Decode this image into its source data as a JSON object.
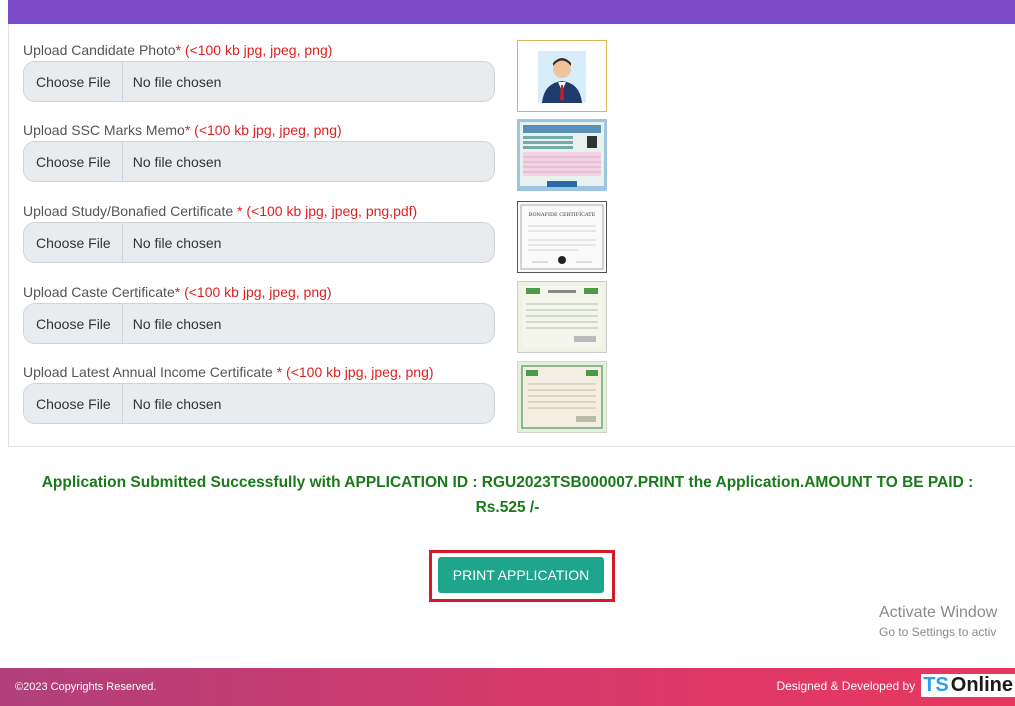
{
  "uploads": [
    {
      "label": "Upload Candidate Photo",
      "req": "* (<100 kb jpg, jpeg, png)",
      "button": "Choose File",
      "status": "No file chosen"
    },
    {
      "label": "Upload SSC Marks Memo",
      "req": "* (<100 kb jpg, jpeg, png)",
      "button": "Choose File",
      "status": "No file chosen"
    },
    {
      "label": "Upload Study/Bonafied Certificate ",
      "req": "* (<100 kb jpg, jpeg, png,pdf)",
      "button": "Choose File",
      "status": "No file chosen"
    },
    {
      "label": "Upload Caste Certificate",
      "req": "* (<100 kb jpg, jpeg, png)",
      "button": "Choose File",
      "status": "No file chosen"
    },
    {
      "label": "Upload Latest Annual Income Certificate  ",
      "req": "* (<100 kb jpg, jpeg, png)",
      "button": "Choose File",
      "status": "No file chosen"
    }
  ],
  "bonafide_title": "BONAFIDE CERTIFICATE",
  "message": {
    "line1": "Application Submitted Successfully with APPLICATION ID : RGU2023TSB000007.PRINT the Application.AMOUNT TO BE PAID :",
    "line2": "Rs.525 /-"
  },
  "print_button": "PRINT APPLICATION",
  "watermark": {
    "line1": "Activate Window",
    "line2": "Go to Settings to activ"
  },
  "footer": {
    "copyright": "©2023 Copyrights Reserved.",
    "designed": "Designed & Developed by",
    "logo_ts": "TS",
    "logo_online": "Online"
  },
  "colors": {
    "header": "#7a4ac6",
    "success": "#1a7a1a",
    "print": "#1fa58c",
    "required": "#e02020"
  }
}
